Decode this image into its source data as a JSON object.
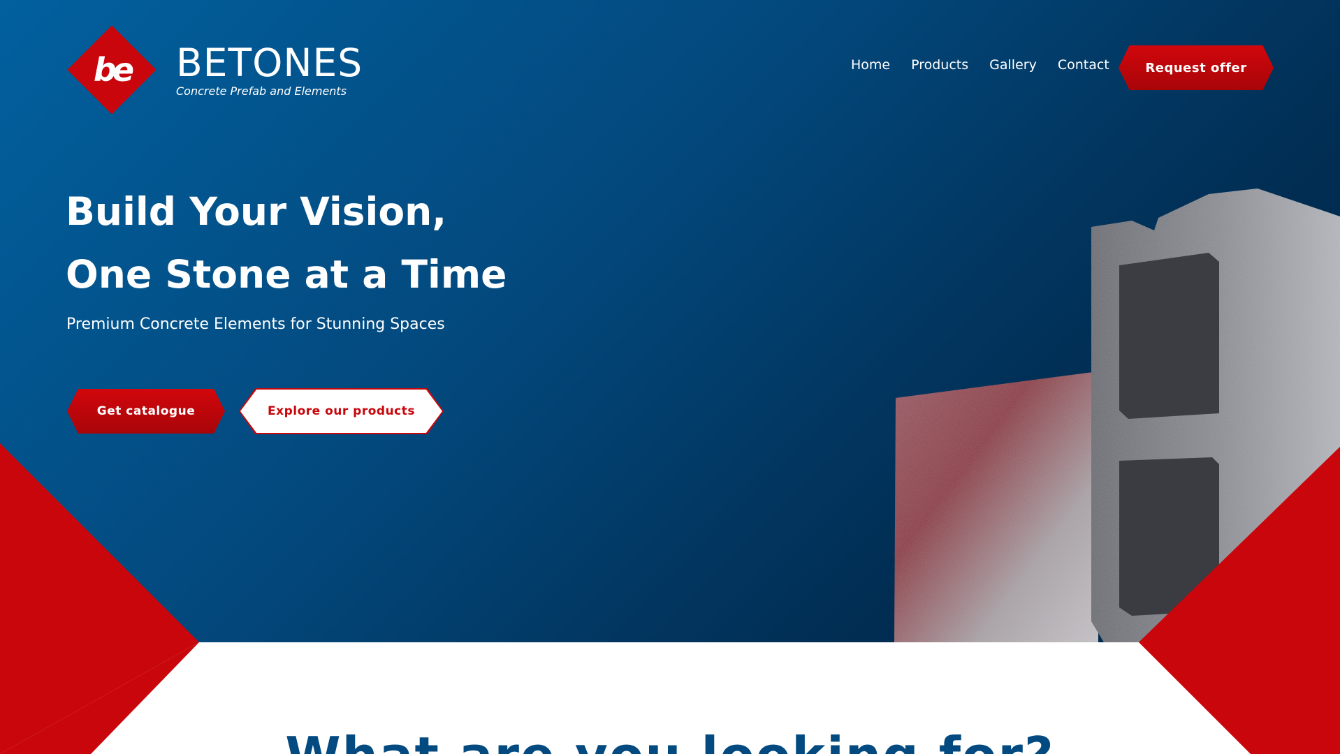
{
  "brand": {
    "mark": "be",
    "name": "BETONES",
    "tagline": "Concrete Prefab and Elements"
  },
  "nav": {
    "items": [
      "Home",
      "Products",
      "Gallery",
      "Contact"
    ],
    "cta": "Request offer"
  },
  "hero": {
    "headline_line1": "Build Your Vision,",
    "headline_line2": "One Stone at a Time",
    "subheadline": "Premium Concrete Elements for Stunning Spaces",
    "primary_button": "Get catalogue",
    "secondary_button": "Explore our products"
  },
  "section": {
    "title": "What are you looking for?"
  },
  "colors": {
    "brand_red": "#c8060b",
    "brand_blue": "#03497e",
    "dark_blue": "#012a4d",
    "white": "#ffffff"
  }
}
